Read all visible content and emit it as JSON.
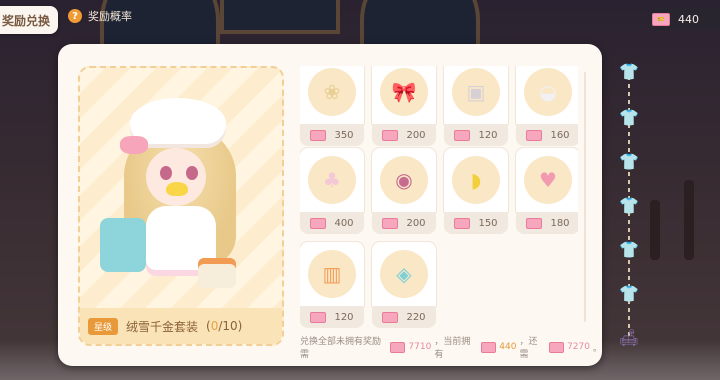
{
  "header": {
    "title": "奖励兑换",
    "probability_label": "奖励概率",
    "question_glyph": "?"
  },
  "currency": {
    "icon": "ticket-icon",
    "amount": "440"
  },
  "featured_set": {
    "rarity": "星级",
    "name": "绒雪千金套装",
    "count_open": "(",
    "count_current": "0",
    "count_total": "/10)"
  },
  "items": [
    {
      "name": "hair-piece",
      "icon": "hair-icon",
      "glyph": "❀",
      "color": "#e9cf93",
      "cost": "350"
    },
    {
      "name": "bow-hat",
      "icon": "bow-hat-icon",
      "glyph": "🎀",
      "color": "#f6b3c4",
      "cost": "200"
    },
    {
      "name": "card-accessory",
      "icon": "card-icon",
      "glyph": "▣",
      "color": "#d6d0d6",
      "cost": "120"
    },
    {
      "name": "white-hat",
      "icon": "hat-icon",
      "glyph": "◒",
      "color": "#f2f0f3",
      "cost": "160"
    },
    {
      "name": "dress-outfit",
      "icon": "dress-icon",
      "glyph": "♣",
      "color": "#f5c8d5",
      "cost": "400"
    },
    {
      "name": "eyes-makeup",
      "icon": "eyes-icon",
      "glyph": "◉",
      "color": "#c86c8f",
      "cost": "200"
    },
    {
      "name": "duck-beak",
      "icon": "duck-beak-icon",
      "glyph": "◗",
      "color": "#f4cf3c",
      "cost": "150"
    },
    {
      "name": "pink-handbag",
      "icon": "handbag-icon",
      "glyph": "♥",
      "color": "#f19ab0",
      "cost": "180"
    },
    {
      "name": "socks-boots",
      "icon": "boots-icon",
      "glyph": "▥",
      "color": "#f2a05a",
      "cost": "120"
    },
    {
      "name": "stroller",
      "icon": "stroller-icon",
      "glyph": "◈",
      "color": "#7fcfd7",
      "cost": "220"
    }
  ],
  "footer": {
    "text_need": "兑换全部未拥有奖励需",
    "need_amount": "7710",
    "text_have": "，当前拥有",
    "have_amount": "440",
    "text_still": "，还需",
    "still_amount": "7270",
    "end": "。"
  },
  "rail": [
    {
      "icon": "shirt-icon",
      "color": "#c9ad7a",
      "glyph": "👕"
    },
    {
      "icon": "shirt-icon",
      "color": "#c9ad7a",
      "glyph": "👕"
    },
    {
      "icon": "shirt-icon-current",
      "color": "#f5d45a",
      "glyph": "👕"
    },
    {
      "icon": "shirt-icon",
      "color": "#a48a63",
      "glyph": "👕"
    },
    {
      "icon": "shirt-icon",
      "color": "#8a6fa8",
      "glyph": "👕"
    },
    {
      "icon": "shirt-icon",
      "color": "#8a6fa8",
      "glyph": "👕"
    },
    {
      "icon": "sofa-icon",
      "color": "#8a6fa8",
      "glyph": "🛋"
    }
  ]
}
